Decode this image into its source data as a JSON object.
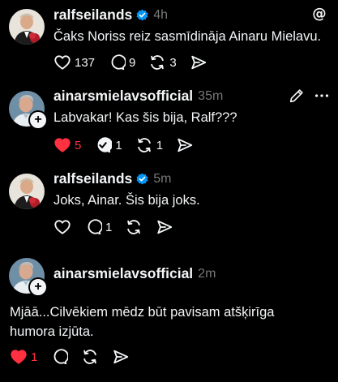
{
  "posts": [
    {
      "username": "ralfseilands",
      "verified": true,
      "time": "4h",
      "text": "Čaks Noriss reiz sasmīdināja Ainaru Mielavu.",
      "likes": "137",
      "comments": "9",
      "reposts": "3"
    },
    {
      "username": "ainarsmielavsofficial",
      "verified": false,
      "time": "35m",
      "text": "Labvakar! Kas šis bija, Ralf???",
      "likes": "5",
      "comments": "1",
      "reposts": "1"
    },
    {
      "username": "ralfseilands",
      "verified": true,
      "time": "5m",
      "text": "Joks, Ainar. Šis bija joks.",
      "likes": "",
      "comments": "1",
      "reposts": ""
    },
    {
      "username": "ainarsmielavsofficial",
      "verified": false,
      "time": "2m",
      "text_line1": "Mjāā...Cilvēkiem mēdz būt pavisam atšķirīga",
      "text_line2": "humora izjūta.",
      "likes": "1",
      "comments": "",
      "reposts": ""
    }
  ],
  "colors": {
    "background": "#000000",
    "text": "#f3f5f7",
    "muted": "#777777",
    "like_red": "#ff3040",
    "verified_blue": "#0095f6"
  },
  "icons": [
    "threads-logo-icon",
    "edit-icon",
    "more-icon",
    "heart-icon",
    "comment-icon",
    "repost-icon",
    "share-icon",
    "verified-icon",
    "plus-icon"
  ]
}
